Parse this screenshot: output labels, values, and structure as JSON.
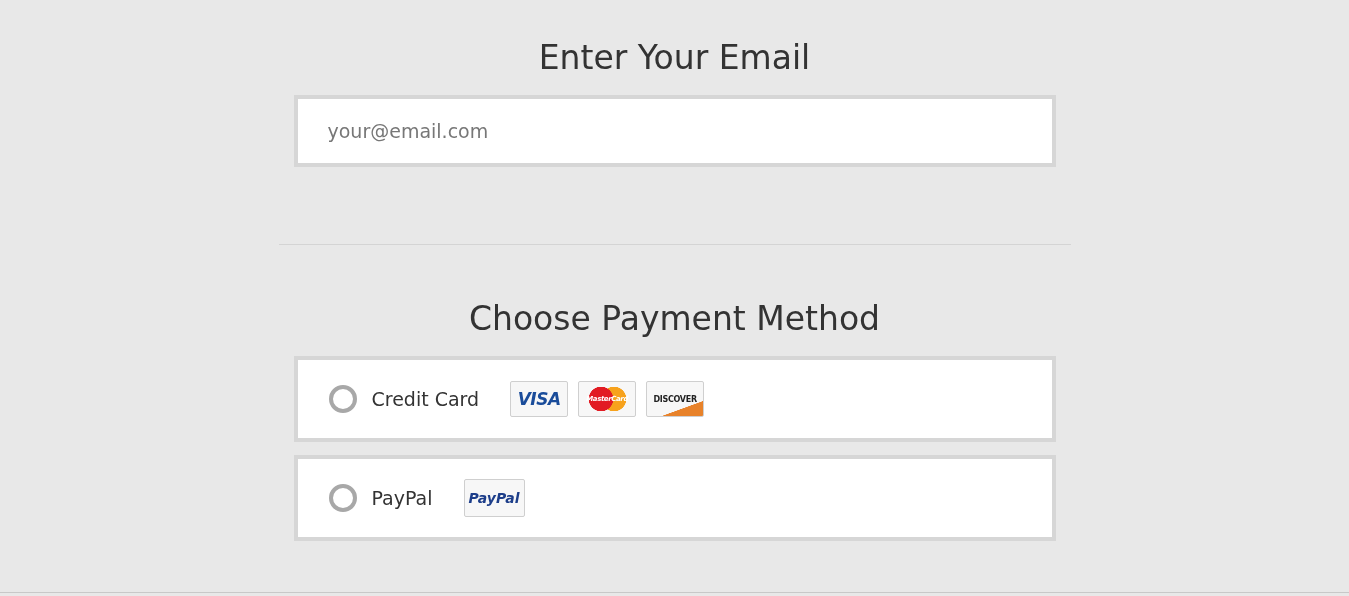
{
  "email_section": {
    "title": "Enter Your Email",
    "field": {
      "placeholder": "your@email.com"
    }
  },
  "payment_section": {
    "title": "Choose Payment Method",
    "options": [
      {
        "label": "Credit Card",
        "selected": false,
        "logos": [
          {
            "kind": "visa",
            "text": "VISA"
          },
          {
            "kind": "mastercard",
            "text": "MasterCard"
          },
          {
            "kind": "discover",
            "text": "DISCOVER"
          }
        ]
      },
      {
        "label": "PayPal",
        "selected": false,
        "logos": [
          {
            "kind": "paypal",
            "text": "PayPal"
          }
        ]
      }
    ]
  }
}
